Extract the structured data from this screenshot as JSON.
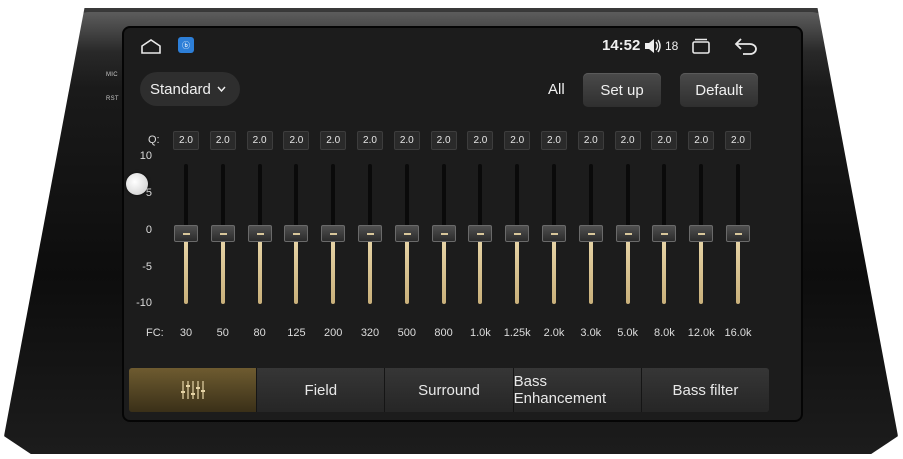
{
  "side_labels": {
    "mic": "MIC",
    "rst": "RST"
  },
  "statusbar": {
    "time": "14:52",
    "volume": "18"
  },
  "toolbar": {
    "preset": "Standard",
    "all_label": "All",
    "setup_label": "Set up",
    "default_label": "Default"
  },
  "equalizer": {
    "q_label": "Q:",
    "fc_label": "FC:",
    "db_scale": [
      "10",
      "5",
      "0",
      "-5",
      "-10"
    ],
    "bands": [
      {
        "fc": "30",
        "q": "2.0",
        "gain": 0
      },
      {
        "fc": "50",
        "q": "2.0",
        "gain": 0
      },
      {
        "fc": "80",
        "q": "2.0",
        "gain": 0
      },
      {
        "fc": "125",
        "q": "2.0",
        "gain": 0
      },
      {
        "fc": "200",
        "q": "2.0",
        "gain": 0
      },
      {
        "fc": "320",
        "q": "2.0",
        "gain": 0
      },
      {
        "fc": "500",
        "q": "2.0",
        "gain": 0
      },
      {
        "fc": "800",
        "q": "2.0",
        "gain": 0
      },
      {
        "fc": "1.0k",
        "q": "2.0",
        "gain": 0
      },
      {
        "fc": "1.25k",
        "q": "2.0",
        "gain": 0
      },
      {
        "fc": "2.0k",
        "q": "2.0",
        "gain": 0
      },
      {
        "fc": "3.0k",
        "q": "2.0",
        "gain": 0
      },
      {
        "fc": "5.0k",
        "q": "2.0",
        "gain": 0
      },
      {
        "fc": "8.0k",
        "q": "2.0",
        "gain": 0
      },
      {
        "fc": "12.0k",
        "q": "2.0",
        "gain": 0
      },
      {
        "fc": "16.0k",
        "q": "2.0",
        "gain": 0
      }
    ]
  },
  "tabs": {
    "eq_icon": "equalizer-icon",
    "field": "Field",
    "surround": "Surround",
    "bass_enhancement": "Bass Enhancement",
    "bass_filter": "Bass filter"
  },
  "colors": {
    "accent": "#d8c69a",
    "active_tab": "#6e5b30",
    "screen": "#1c1c1c"
  }
}
